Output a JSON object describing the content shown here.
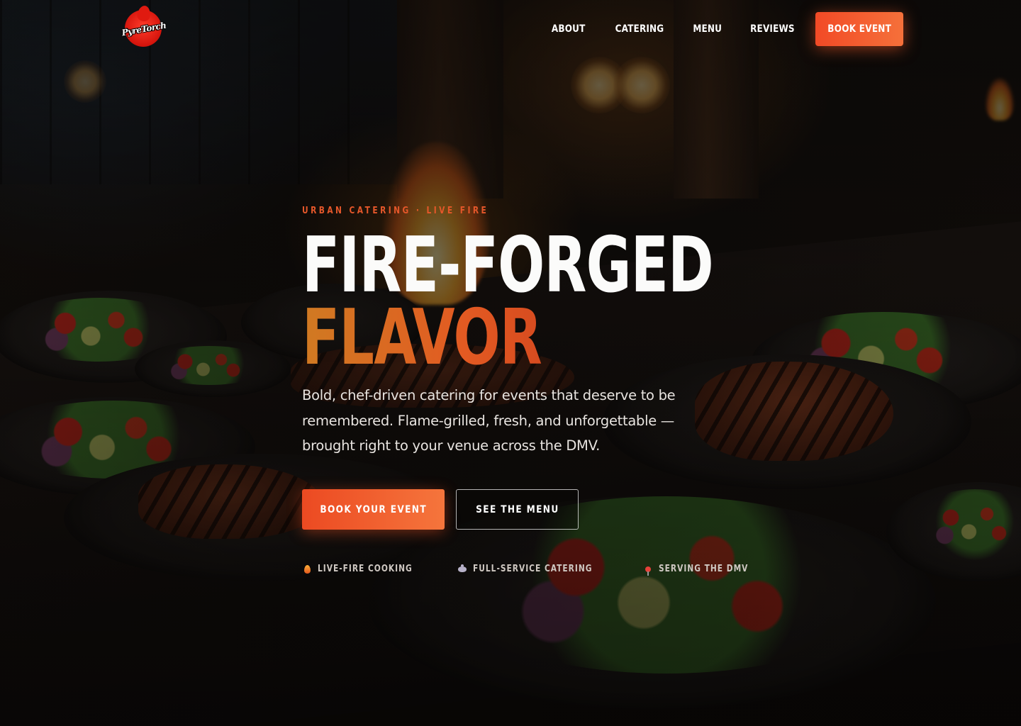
{
  "brand": {
    "logo_text": "PyreTorch",
    "accent": "#F24A26",
    "accent_light": "#F5703A"
  },
  "nav": {
    "items": [
      {
        "label": "ABOUT"
      },
      {
        "label": "CATERING"
      },
      {
        "label": "MENU"
      },
      {
        "label": "REVIEWS"
      }
    ],
    "cta_label": "BOOK EVENT"
  },
  "hero": {
    "eyebrow": "URBAN CATERING · LIVE FIRE",
    "title_line1": "FIRE-FORGED",
    "title_line2": "FLAVOR",
    "lead": "Bold, chef-driven catering for events that deserve to be remembered. Flame-grilled, fresh, and unforgettable — brought right to your venue across the DMV.",
    "primary_cta": "BOOK YOUR EVENT",
    "secondary_cta": "SEE THE MENU",
    "features": [
      {
        "icon": "flame-icon",
        "label": "LIVE-FIRE COOKING"
      },
      {
        "icon": "plate-icon",
        "label": "FULL-SERVICE CATERING"
      },
      {
        "icon": "pin-icon",
        "label": "SERVING THE DMV"
      }
    ]
  }
}
